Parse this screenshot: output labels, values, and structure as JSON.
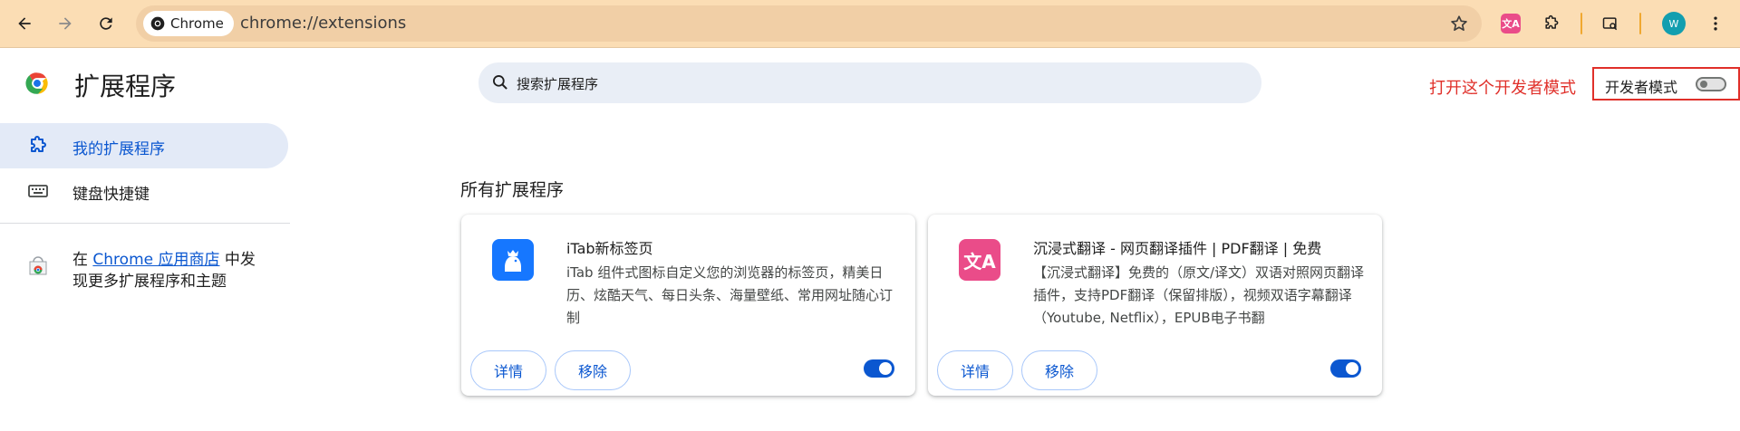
{
  "browser": {
    "chip_label": "Chrome",
    "url": "chrome://extensions",
    "avatar_letter": "W"
  },
  "header": {
    "title": "扩展程序",
    "search_placeholder": "搜索扩展程序",
    "annotation": "打开这个开发者模式",
    "dev_mode_label": "开发者模式",
    "dev_mode_enabled": false
  },
  "sidebar": {
    "items": [
      {
        "label": "我的扩展程序",
        "selected": true
      },
      {
        "label": "键盘快捷键",
        "selected": false
      }
    ],
    "store_prefix": "在 ",
    "store_link": "Chrome 应用商店",
    "store_suffix": " 中发",
    "store_line2": "现更多扩展程序和主题"
  },
  "main": {
    "section_title": "所有扩展程序",
    "extensions": [
      {
        "name": "iTab新标签页",
        "description": "iTab 组件式图标自定义您的浏览器的标签页，精美日历、炫酷天气、每日头条、海量壁纸、常用网址随心订制",
        "details_label": "详情",
        "remove_label": "移除",
        "enabled": true,
        "icon_color": "#1677ff"
      },
      {
        "name": "沉浸式翻译 - 网页翻译插件 | PDF翻译 | 免费",
        "description": "【沉浸式翻译】免费的（原文/译文）双语对照网页翻译插件，支持PDF翻译（保留排版），视频双语字幕翻译（Youtube, Netflix），EPUB电子书翻",
        "details_label": "详情",
        "remove_label": "移除",
        "enabled": true,
        "icon_color": "#ea4c89"
      }
    ]
  },
  "colors": {
    "toolbar": "#fbddb4",
    "accent": "#0b57d0",
    "annotation": "#e0302a"
  }
}
